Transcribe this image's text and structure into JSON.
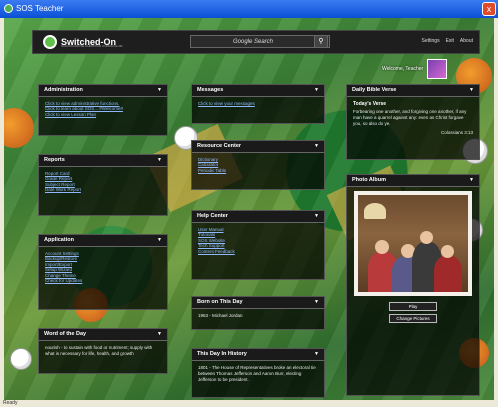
{
  "window": {
    "title": "SOS Teacher",
    "close_glyph": "x"
  },
  "header": {
    "logo_text": "Switched-On",
    "logo_sub": "SCHOOLHOUSE   CHRISTIAN CURRICULUM",
    "search_placeholder": "Google Search",
    "search_icon": "magnifier-icon",
    "nav": [
      "Settings",
      "Exit",
      "About"
    ],
    "welcome": "Welcome, Teacher"
  },
  "panels": {
    "administration": {
      "title": "Administration",
      "links": [
        "Click to view administrative functions.",
        "Click to learn about SOS... #Welcome#",
        "Click to view Lesson Plan"
      ]
    },
    "reports": {
      "title": "Reports",
      "links": [
        "Report Card",
        "Grade Report",
        "Subject Report",
        "Date Work Report"
      ]
    },
    "application": {
      "title": "Application",
      "links": [
        "Account Settings",
        "Backup/Restore",
        "Import/Export",
        "Setup Wizard",
        "Change Theme",
        "Check for Updates"
      ]
    },
    "word_of_day": {
      "title": "Word of the Day",
      "text": "nourish - to sustain with food or nutriment; supply with what is necessary for life, health, and growth"
    },
    "messages": {
      "title": "Messages",
      "links": [
        "Click to view your messages"
      ]
    },
    "resource_center": {
      "title": "Resource Center",
      "links": [
        "Dictionary",
        "Calculator",
        "Periodic Table"
      ]
    },
    "help_center": {
      "title": "Help Center",
      "links": [
        "User Manual",
        "Tutorials",
        "SOS Website",
        "Tech Support",
        "Content Feedback"
      ]
    },
    "born_on_day": {
      "title": "Born on This Day",
      "text": "1963 - Michael Jordan"
    },
    "history": {
      "title": "This Day In History",
      "text": "1801 - The House of Representatives broke an electoral tie between Thomas Jefferson and Aaron Burr, electing Jefferson to be president."
    },
    "verse": {
      "title": "Daily Bible Verse",
      "heading": "Today's Verse",
      "text": "Forbearing one another, and forgiving one another, if any man have a quarrel against any: even as Christ forgave you, so also do ye.",
      "reference": "Colossians 3:13"
    },
    "photo_album": {
      "title": "Photo Album",
      "play_label": "Play",
      "change_label": "Change Pictures"
    }
  },
  "status_text": "Ready"
}
